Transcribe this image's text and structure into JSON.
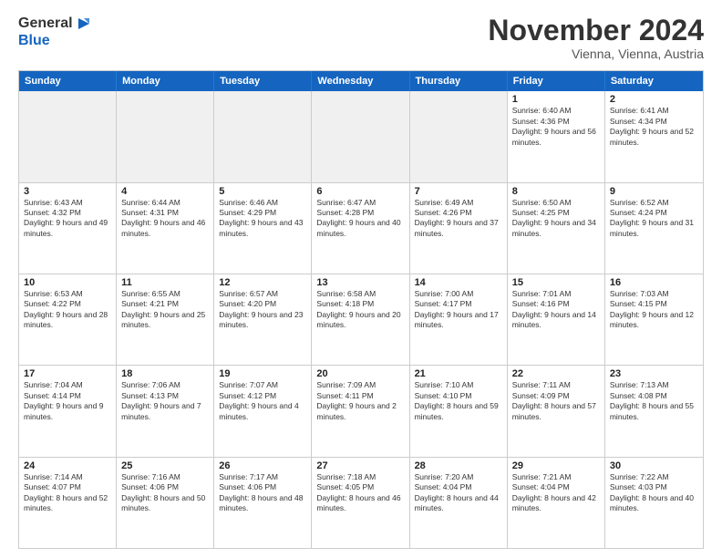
{
  "logo": {
    "general": "General",
    "blue": "Blue"
  },
  "title": "November 2024",
  "location": "Vienna, Vienna, Austria",
  "days": [
    "Sunday",
    "Monday",
    "Tuesday",
    "Wednesday",
    "Thursday",
    "Friday",
    "Saturday"
  ],
  "weeks": [
    [
      {
        "day": "",
        "info": ""
      },
      {
        "day": "",
        "info": ""
      },
      {
        "day": "",
        "info": ""
      },
      {
        "day": "",
        "info": ""
      },
      {
        "day": "",
        "info": ""
      },
      {
        "day": "1",
        "info": "Sunrise: 6:40 AM\nSunset: 4:36 PM\nDaylight: 9 hours and 56 minutes."
      },
      {
        "day": "2",
        "info": "Sunrise: 6:41 AM\nSunset: 4:34 PM\nDaylight: 9 hours and 52 minutes."
      }
    ],
    [
      {
        "day": "3",
        "info": "Sunrise: 6:43 AM\nSunset: 4:32 PM\nDaylight: 9 hours and 49 minutes."
      },
      {
        "day": "4",
        "info": "Sunrise: 6:44 AM\nSunset: 4:31 PM\nDaylight: 9 hours and 46 minutes."
      },
      {
        "day": "5",
        "info": "Sunrise: 6:46 AM\nSunset: 4:29 PM\nDaylight: 9 hours and 43 minutes."
      },
      {
        "day": "6",
        "info": "Sunrise: 6:47 AM\nSunset: 4:28 PM\nDaylight: 9 hours and 40 minutes."
      },
      {
        "day": "7",
        "info": "Sunrise: 6:49 AM\nSunset: 4:26 PM\nDaylight: 9 hours and 37 minutes."
      },
      {
        "day": "8",
        "info": "Sunrise: 6:50 AM\nSunset: 4:25 PM\nDaylight: 9 hours and 34 minutes."
      },
      {
        "day": "9",
        "info": "Sunrise: 6:52 AM\nSunset: 4:24 PM\nDaylight: 9 hours and 31 minutes."
      }
    ],
    [
      {
        "day": "10",
        "info": "Sunrise: 6:53 AM\nSunset: 4:22 PM\nDaylight: 9 hours and 28 minutes."
      },
      {
        "day": "11",
        "info": "Sunrise: 6:55 AM\nSunset: 4:21 PM\nDaylight: 9 hours and 25 minutes."
      },
      {
        "day": "12",
        "info": "Sunrise: 6:57 AM\nSunset: 4:20 PM\nDaylight: 9 hours and 23 minutes."
      },
      {
        "day": "13",
        "info": "Sunrise: 6:58 AM\nSunset: 4:18 PM\nDaylight: 9 hours and 20 minutes."
      },
      {
        "day": "14",
        "info": "Sunrise: 7:00 AM\nSunset: 4:17 PM\nDaylight: 9 hours and 17 minutes."
      },
      {
        "day": "15",
        "info": "Sunrise: 7:01 AM\nSunset: 4:16 PM\nDaylight: 9 hours and 14 minutes."
      },
      {
        "day": "16",
        "info": "Sunrise: 7:03 AM\nSunset: 4:15 PM\nDaylight: 9 hours and 12 minutes."
      }
    ],
    [
      {
        "day": "17",
        "info": "Sunrise: 7:04 AM\nSunset: 4:14 PM\nDaylight: 9 hours and 9 minutes."
      },
      {
        "day": "18",
        "info": "Sunrise: 7:06 AM\nSunset: 4:13 PM\nDaylight: 9 hours and 7 minutes."
      },
      {
        "day": "19",
        "info": "Sunrise: 7:07 AM\nSunset: 4:12 PM\nDaylight: 9 hours and 4 minutes."
      },
      {
        "day": "20",
        "info": "Sunrise: 7:09 AM\nSunset: 4:11 PM\nDaylight: 9 hours and 2 minutes."
      },
      {
        "day": "21",
        "info": "Sunrise: 7:10 AM\nSunset: 4:10 PM\nDaylight: 8 hours and 59 minutes."
      },
      {
        "day": "22",
        "info": "Sunrise: 7:11 AM\nSunset: 4:09 PM\nDaylight: 8 hours and 57 minutes."
      },
      {
        "day": "23",
        "info": "Sunrise: 7:13 AM\nSunset: 4:08 PM\nDaylight: 8 hours and 55 minutes."
      }
    ],
    [
      {
        "day": "24",
        "info": "Sunrise: 7:14 AM\nSunset: 4:07 PM\nDaylight: 8 hours and 52 minutes."
      },
      {
        "day": "25",
        "info": "Sunrise: 7:16 AM\nSunset: 4:06 PM\nDaylight: 8 hours and 50 minutes."
      },
      {
        "day": "26",
        "info": "Sunrise: 7:17 AM\nSunset: 4:06 PM\nDaylight: 8 hours and 48 minutes."
      },
      {
        "day": "27",
        "info": "Sunrise: 7:18 AM\nSunset: 4:05 PM\nDaylight: 8 hours and 46 minutes."
      },
      {
        "day": "28",
        "info": "Sunrise: 7:20 AM\nSunset: 4:04 PM\nDaylight: 8 hours and 44 minutes."
      },
      {
        "day": "29",
        "info": "Sunrise: 7:21 AM\nSunset: 4:04 PM\nDaylight: 8 hours and 42 minutes."
      },
      {
        "day": "30",
        "info": "Sunrise: 7:22 AM\nSunset: 4:03 PM\nDaylight: 8 hours and 40 minutes."
      }
    ]
  ]
}
